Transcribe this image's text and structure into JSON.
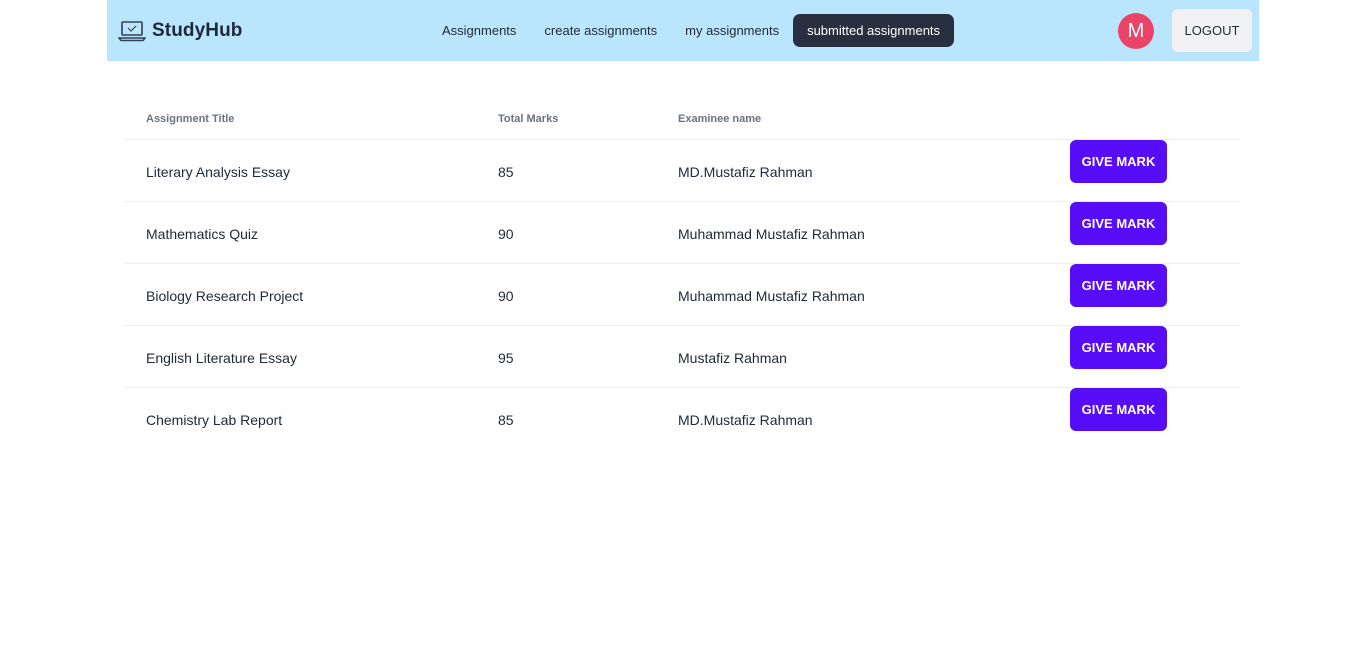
{
  "brand": {
    "name": "StudyHub",
    "icon": "laptop-icon"
  },
  "nav": {
    "items": [
      {
        "label": "Assignments",
        "active": false
      },
      {
        "label": "create assignments",
        "active": false
      },
      {
        "label": "my assignments",
        "active": false
      },
      {
        "label": "submitted assignments",
        "active": true
      }
    ]
  },
  "user": {
    "avatar_initial": "M",
    "avatar_color": "#ec4369"
  },
  "logout_label": "LOGOUT",
  "table": {
    "headers": [
      "Assignment Title",
      "Total Marks",
      "Examinee name"
    ],
    "action_label": "GIVE MARK",
    "rows": [
      {
        "title": "Literary Analysis Essay",
        "marks": "85",
        "examinee": "MD.Mustafiz Rahman"
      },
      {
        "title": "Mathematics Quiz",
        "marks": "90",
        "examinee": "Muhammad Mustafiz Rahman"
      },
      {
        "title": "Biology Research Project",
        "marks": "90",
        "examinee": "Muhammad Mustafiz Rahman"
      },
      {
        "title": "English Literature Essay",
        "marks": "95",
        "examinee": "Mustafiz Rahman"
      },
      {
        "title": "Chemistry Lab Report",
        "marks": "85",
        "examinee": "MD.Mustafiz Rahman"
      }
    ]
  },
  "colors": {
    "navbar": "#bae6fd",
    "accent": "#570df8",
    "active_nav": "#283040"
  }
}
